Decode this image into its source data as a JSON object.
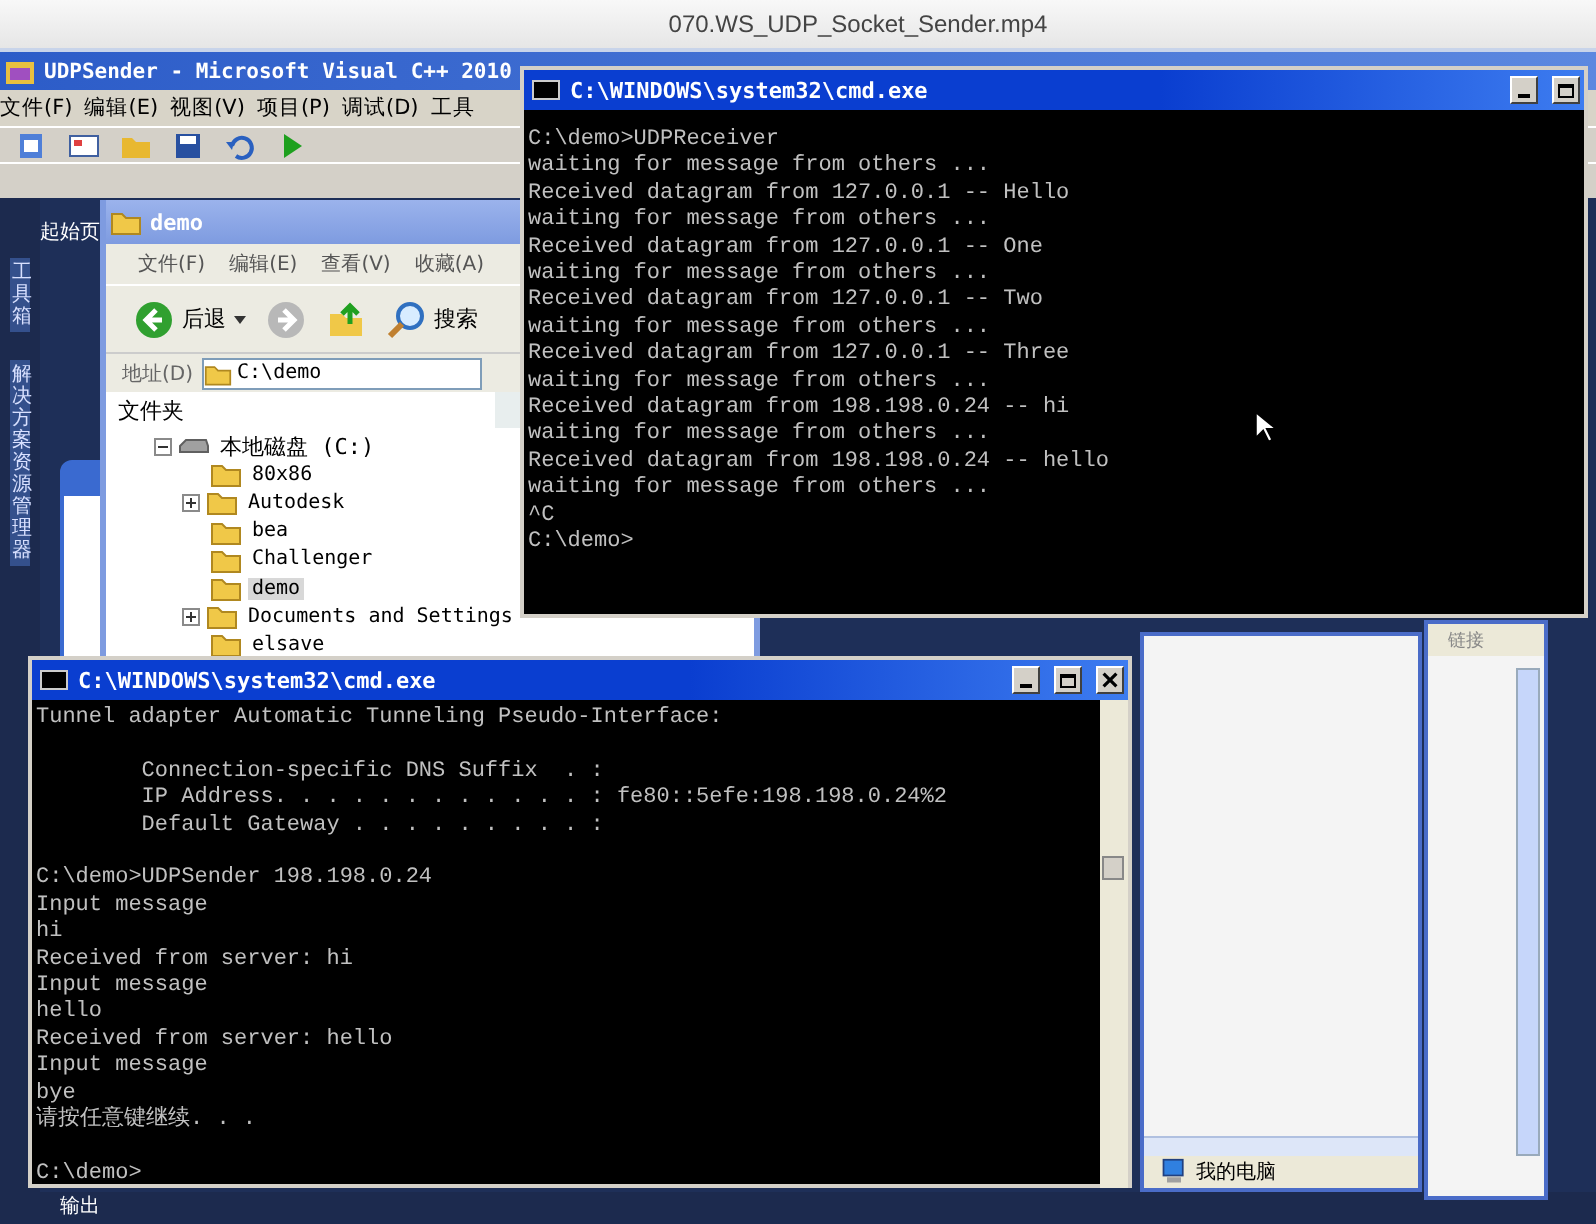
{
  "player": {
    "title": "070.WS_UDP_Socket_Sender.mp4"
  },
  "ide": {
    "title": "UDPSender - Microsoft Visual C++ 2010",
    "menu": [
      "文件(F)",
      "编辑(E)",
      "视图(V)",
      "项目(P)",
      "调试(D)",
      "工具"
    ],
    "side_tabs": [
      "工具箱",
      "解决方案资源管理器"
    ],
    "doc_tab": "起始页",
    "output_tab": "输出"
  },
  "explorer": {
    "title": "demo",
    "menu": [
      "文件(F)",
      "编辑(E)",
      "查看(V)",
      "收藏(A)"
    ],
    "back_label": "后退",
    "search_label": "搜索",
    "address_label": "地址(D)",
    "address": "C:\\demo",
    "folders_header": "文件夹",
    "tree": [
      {
        "label": "本地磁盘 (C:)",
        "expanded": true,
        "selected": false,
        "children": [
          {
            "label": "80x86",
            "expandable": false,
            "selected": false
          },
          {
            "label": "Autodesk",
            "expandable": true,
            "selected": false
          },
          {
            "label": "bea",
            "expandable": false,
            "selected": false
          },
          {
            "label": "Challenger",
            "expandable": false,
            "selected": false
          },
          {
            "label": "demo",
            "expandable": false,
            "selected": true
          },
          {
            "label": "Documents and Settings",
            "expandable": true,
            "selected": false
          },
          {
            "label": "elsave",
            "expandable": false,
            "selected": false
          }
        ]
      }
    ]
  },
  "cmd_receiver": {
    "title": "C:\\WINDOWS\\system32\\cmd.exe",
    "blocks": [
      [
        "C:\\demo>UDPReceiver",
        "waiting for message from others ...",
        "Received datagram from 127.0.0.1 -- Hello",
        "waiting for message from others ...",
        "Received datagram from 127.0.0.1 -- One",
        "waiting for message from others ...",
        "Received datagram from 127.0.0.1 -- Two",
        "waiting for message from others ...",
        "Received datagram from 127.0.0.1 -- Three",
        "waiting for message from others ...",
        "Received datagram from 198.198.0.24 -- hi",
        "waiting for message from others ...",
        "Received datagram from 198.198.0.24 -- hello",
        "waiting for message from others ...",
        "^C",
        "C:\\demo>"
      ]
    ]
  },
  "cmd_sender": {
    "title": "C:\\WINDOWS\\system32\\cmd.exe",
    "blocks": [
      [
        "Tunnel adapter Automatic Tunneling Pseudo-Interface:"
      ],
      [
        "        Connection-specific DNS Suffix  . :",
        "        IP Address. . . . . . . . . . . . : fe80::5efe:198.198.0.24%2",
        "        Default Gateway . . . . . . . . . :"
      ],
      [
        "C:\\demo>UDPSender 198.198.0.24",
        "Input message",
        "hi",
        "Received from server: hi",
        "Input message",
        "hello",
        "Received from server: hello",
        "Input message",
        "bye",
        "请按任意键继续. . ."
      ],
      [
        "C:\\demo>"
      ]
    ]
  },
  "my_computer": {
    "status": "我的电脑"
  },
  "links_bar": {
    "label": "链接"
  }
}
